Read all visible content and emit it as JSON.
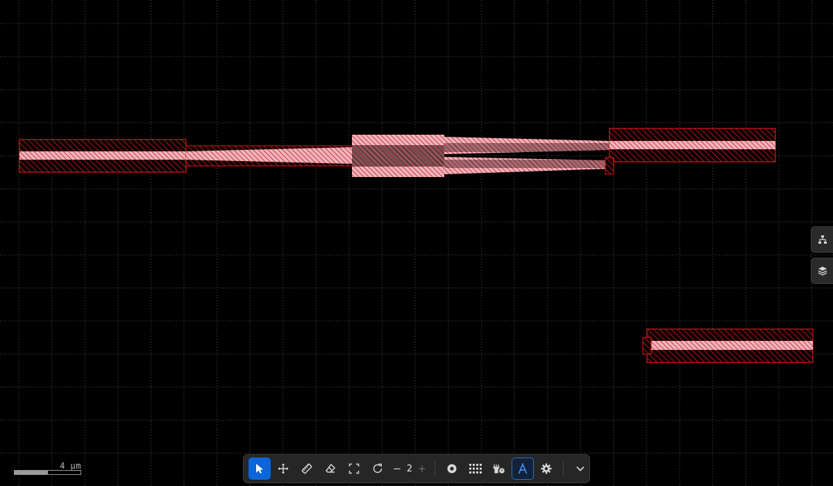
{
  "scale": {
    "label": "4 μm"
  },
  "side_panel": {
    "items": [
      {
        "name": "hierarchy",
        "icon": "hierarchy-icon"
      },
      {
        "name": "layers",
        "icon": "layers-icon"
      }
    ]
  },
  "toolbar": {
    "tools": [
      {
        "name": "select",
        "icon": "cursor-icon",
        "active": true
      },
      {
        "name": "pan",
        "icon": "move-icon"
      },
      {
        "name": "ruler",
        "icon": "ruler-icon"
      },
      {
        "name": "erase",
        "icon": "eraser-icon"
      },
      {
        "name": "fit",
        "icon": "fit-icon"
      },
      {
        "name": "reset",
        "icon": "rotate-icon"
      }
    ],
    "depth_stepper": {
      "value": "2",
      "decrement": "−",
      "increment": "+"
    },
    "extra": [
      {
        "name": "fill-mode",
        "icon": "record-icon"
      },
      {
        "name": "grid",
        "icon": "grid-icon"
      },
      {
        "name": "ports",
        "icon": "ports-icon"
      },
      {
        "name": "labels",
        "icon": "label-a-icon",
        "toggled": true
      },
      {
        "name": "settings",
        "icon": "gear-icon"
      },
      {
        "name": "collapse",
        "icon": "chevron-down-icon"
      }
    ]
  },
  "colors": {
    "background": "#000000",
    "grid_dot": "#6a6a6a",
    "shape_outline": "#e0141b",
    "shape_hatch": "#a01218",
    "waveguide_fill": "#f2aeb6",
    "toolbar_bg": "#262626",
    "active_blue": "#0a66d9",
    "icon": "#d6d6d6"
  }
}
